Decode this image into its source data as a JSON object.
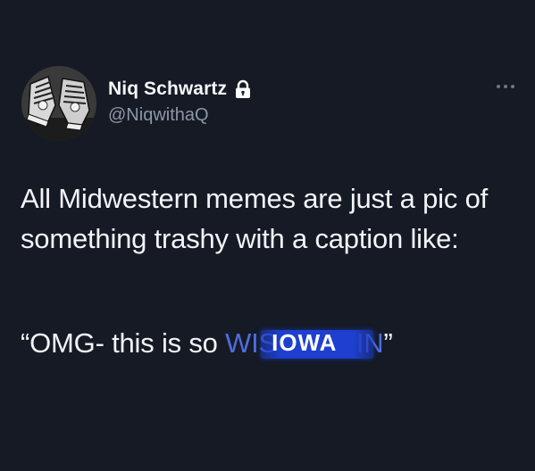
{
  "author": {
    "display_name": "Niq Schwartz",
    "handle": "@NiqwithaQ",
    "protected": true,
    "avatar_icon": "sneakers-avatar"
  },
  "menu": {
    "icon": "more-horizontal-icon"
  },
  "tweet": {
    "text": "All Midwestern memes are just a pic of something trashy with a caption like:",
    "quote_prefix": "“OMG- this is so ",
    "struck_word": "WISCONSIN",
    "overlay_word": "IOWA",
    "quote_suffix": "”"
  },
  "colors": {
    "background": "#151a25",
    "text": "#f2f4f7",
    "secondary_text": "#8b98a5",
    "highlight": "#1e3fd0"
  }
}
